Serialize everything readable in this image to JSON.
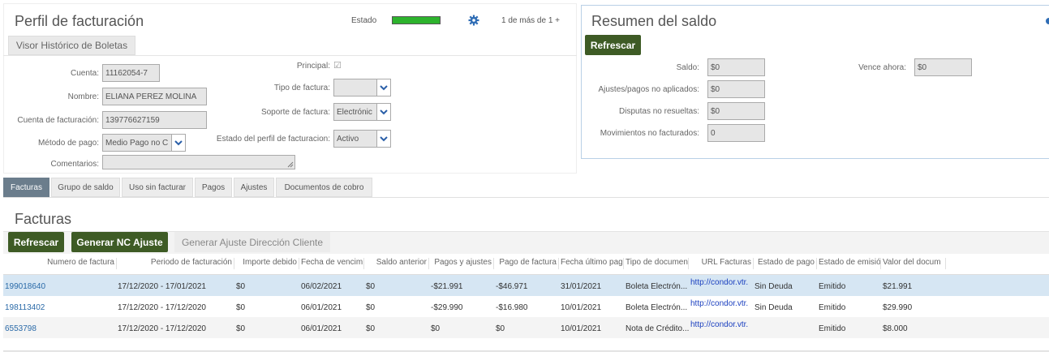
{
  "profile": {
    "title": "Perfil de facturación",
    "estado_label": "Estado",
    "pager": "1 de más de 1",
    "pager_arrow": "+",
    "subtitle_button": "Visor Histórico de Boletas",
    "fields": {
      "cuenta_label": "Cuenta:",
      "cuenta_value": "11162054-7",
      "nombre_label": "Nombre:",
      "nombre_value": "ELIANA PEREZ MOLINA",
      "cuenta_fact_label": "Cuenta de facturación:",
      "cuenta_fact_value": "139776627159",
      "metodo_label": "Método de pago:",
      "metodo_value": "Medio Pago no C",
      "comentarios_label": "Comentarios:",
      "principal_label": "Principal:",
      "principal_mark": "☑",
      "tipo_label": "Tipo de factura:",
      "tipo_value": "",
      "soporte_label": "Soporte de factura:",
      "soporte_value": "Electrónic",
      "estado_perfil_label": "Estado del perfil de facturacion:",
      "estado_perfil_value": "Activo"
    }
  },
  "balance": {
    "title": "Resumen del saldo",
    "refresh_button": "Refrescar",
    "saldo_label": "Saldo:",
    "saldo_value": "$0",
    "vence_label": "Vence ahora:",
    "vence_value": "$0",
    "ajustes_label": "Ajustes/pagos no aplicados:",
    "ajustes_value": "$0",
    "disputas_label": "Disputas no resueltas:",
    "disputas_value": "$0",
    "movimientos_label": "Movimientos no facturados:",
    "movimientos_value": "0"
  },
  "tabs": [
    "Facturas",
    "Grupo de saldo",
    "Uso sin facturar",
    "Pagos",
    "Ajustes",
    "Documentos de cobro"
  ],
  "invoices": {
    "title": "Facturas",
    "refresh_button": "Refrescar",
    "nc_button": "Generar NC Ajuste",
    "ajuste_button": "Generar Ajuste Dirección Cliente",
    "columns": [
      "Numero de factura",
      "Periodo de facturación",
      "Importe debido",
      "Fecha de vencim",
      "Saldo anterior",
      "Pagos y ajustes",
      "Pago de factura",
      "Fecha último pag",
      "Tipo de documen",
      "URL Facturas",
      "Estado de pago",
      "Estado de emisió",
      "Valor del docum"
    ],
    "rows": [
      [
        "199018640",
        "17/12/2020 - 17/01/2021",
        "$0",
        "06/02/2021",
        "$0",
        "-$21.991",
        "-$46.971",
        "31/01/2021",
        "Boleta Electrón...",
        "http://condor.vtr.",
        "Sin Deuda",
        "Emitido",
        "$21.991"
      ],
      [
        "198113402",
        "17/12/2020 - 17/12/2020",
        "$0",
        "06/01/2021",
        "$0",
        "-$29.990",
        "-$16.980",
        "10/01/2021",
        "Boleta Electrón...",
        "http://condor.vtr.",
        "Sin Deuda",
        "Emitido",
        "$29.990"
      ],
      [
        "6553798",
        "17/12/2020 - 17/12/2020",
        "$0",
        "06/01/2021",
        "$0",
        "$0",
        "$0",
        "10/01/2021",
        "Nota de Crédito...",
        "http://condor.vtr.",
        "",
        "Emitido",
        "$8.000"
      ]
    ]
  },
  "colors": {
    "accent_green": "#3e5b25",
    "status_bar": "#2db32d",
    "selected_row": "#d6e6f3",
    "link": "#2a6aa8",
    "gear": "#2f6db5"
  }
}
